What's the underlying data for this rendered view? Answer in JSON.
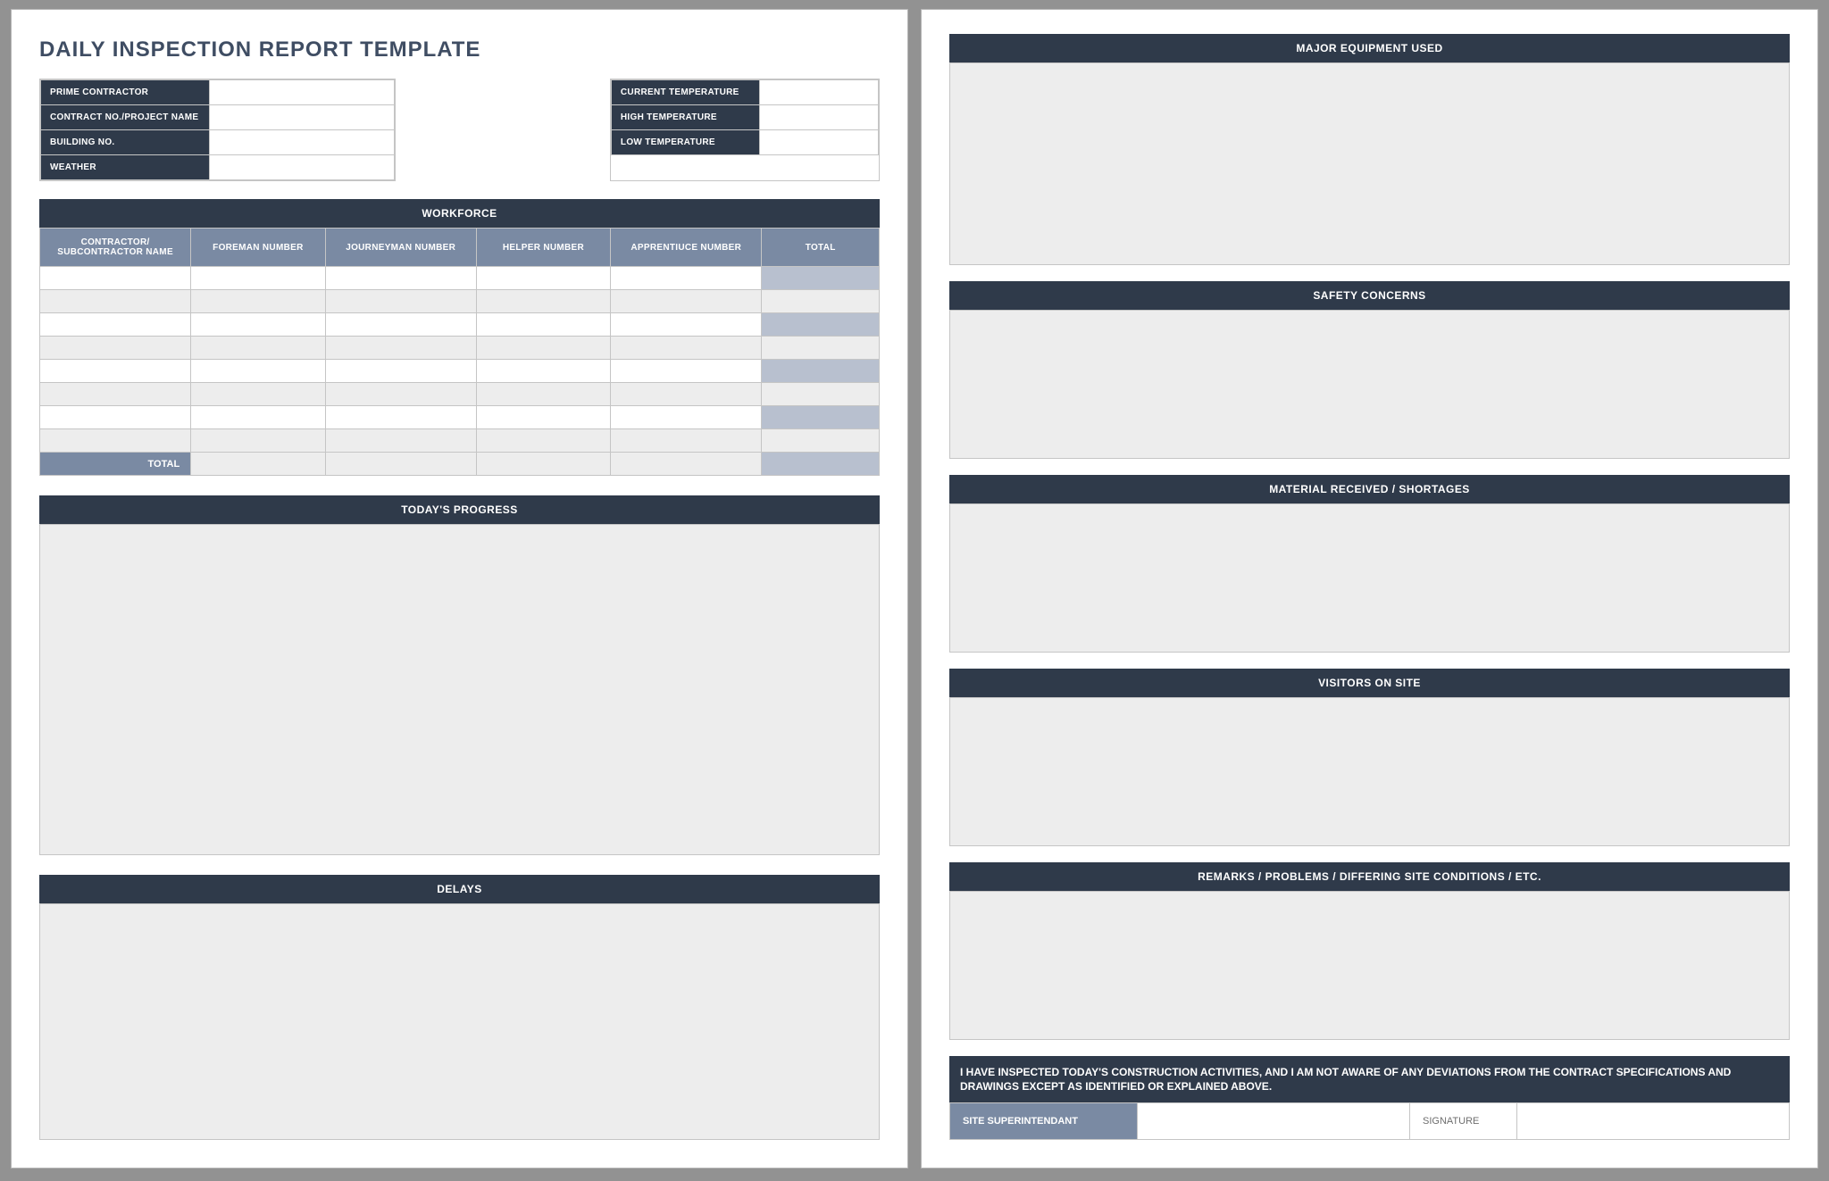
{
  "title": "DAILY INSPECTION REPORT TEMPLATE",
  "meta_left": {
    "prime_contractor": {
      "label": "PRIME CONTRACTOR",
      "value": ""
    },
    "contract_no": {
      "label": "CONTRACT NO./PROJECT NAME",
      "value": ""
    },
    "building_no": {
      "label": "BUILDING NO.",
      "value": ""
    },
    "weather": {
      "label": "WEATHER",
      "value": ""
    }
  },
  "meta_right": {
    "cur_temp": {
      "label": "CURRENT TEMPERATURE",
      "value": ""
    },
    "high_temp": {
      "label": "HIGH TEMPERATURE",
      "value": ""
    },
    "low_temp": {
      "label": "LOW TEMPERATURE",
      "value": ""
    }
  },
  "workforce": {
    "title": "WORKFORCE",
    "cols": [
      "CONTRACTOR/ SUBCONTRACTOR NAME",
      "FOREMAN NUMBER",
      "JOURNEYMAN NUMBER",
      "HELPER NUMBER",
      "APPRENTIUCE NUMBER",
      "TOTAL"
    ],
    "rows": [
      [
        "",
        "",
        "",
        "",
        "",
        ""
      ],
      [
        "",
        "",
        "",
        "",
        "",
        ""
      ],
      [
        "",
        "",
        "",
        "",
        "",
        ""
      ],
      [
        "",
        "",
        "",
        "",
        "",
        ""
      ],
      [
        "",
        "",
        "",
        "",
        "",
        ""
      ],
      [
        "",
        "",
        "",
        "",
        "",
        ""
      ],
      [
        "",
        "",
        "",
        "",
        "",
        ""
      ],
      [
        "",
        "",
        "",
        "",
        "",
        ""
      ]
    ],
    "total_label": "TOTAL"
  },
  "sections_a": {
    "progress": "TODAY'S PROGRESS",
    "delays": "DELAYS"
  },
  "sections_b": {
    "major": "MAJOR EQUIPMENT USED",
    "safety": "SAFETY CONCERNS",
    "mat": "MATERIAL RECEIVED / SHORTAGES",
    "vis": "VISITORS ON SITE",
    "rem": "REMARKS / PROBLEMS / DIFFERING SITE CONDITIONS / ETC."
  },
  "cert": "I HAVE INSPECTED TODAY'S CONSTRUCTION ACTIVITIES, AND I AM NOT AWARE OF ANY DEVIATIONS FROM THE CONTRACT SPECIFICATIONS AND DRAWINGS EXCEPT AS IDENTIFIED OR EXPLAINED ABOVE.",
  "sig": {
    "site_super": "SITE SUPERINTENDANT",
    "signature": "SIGNATURE"
  }
}
